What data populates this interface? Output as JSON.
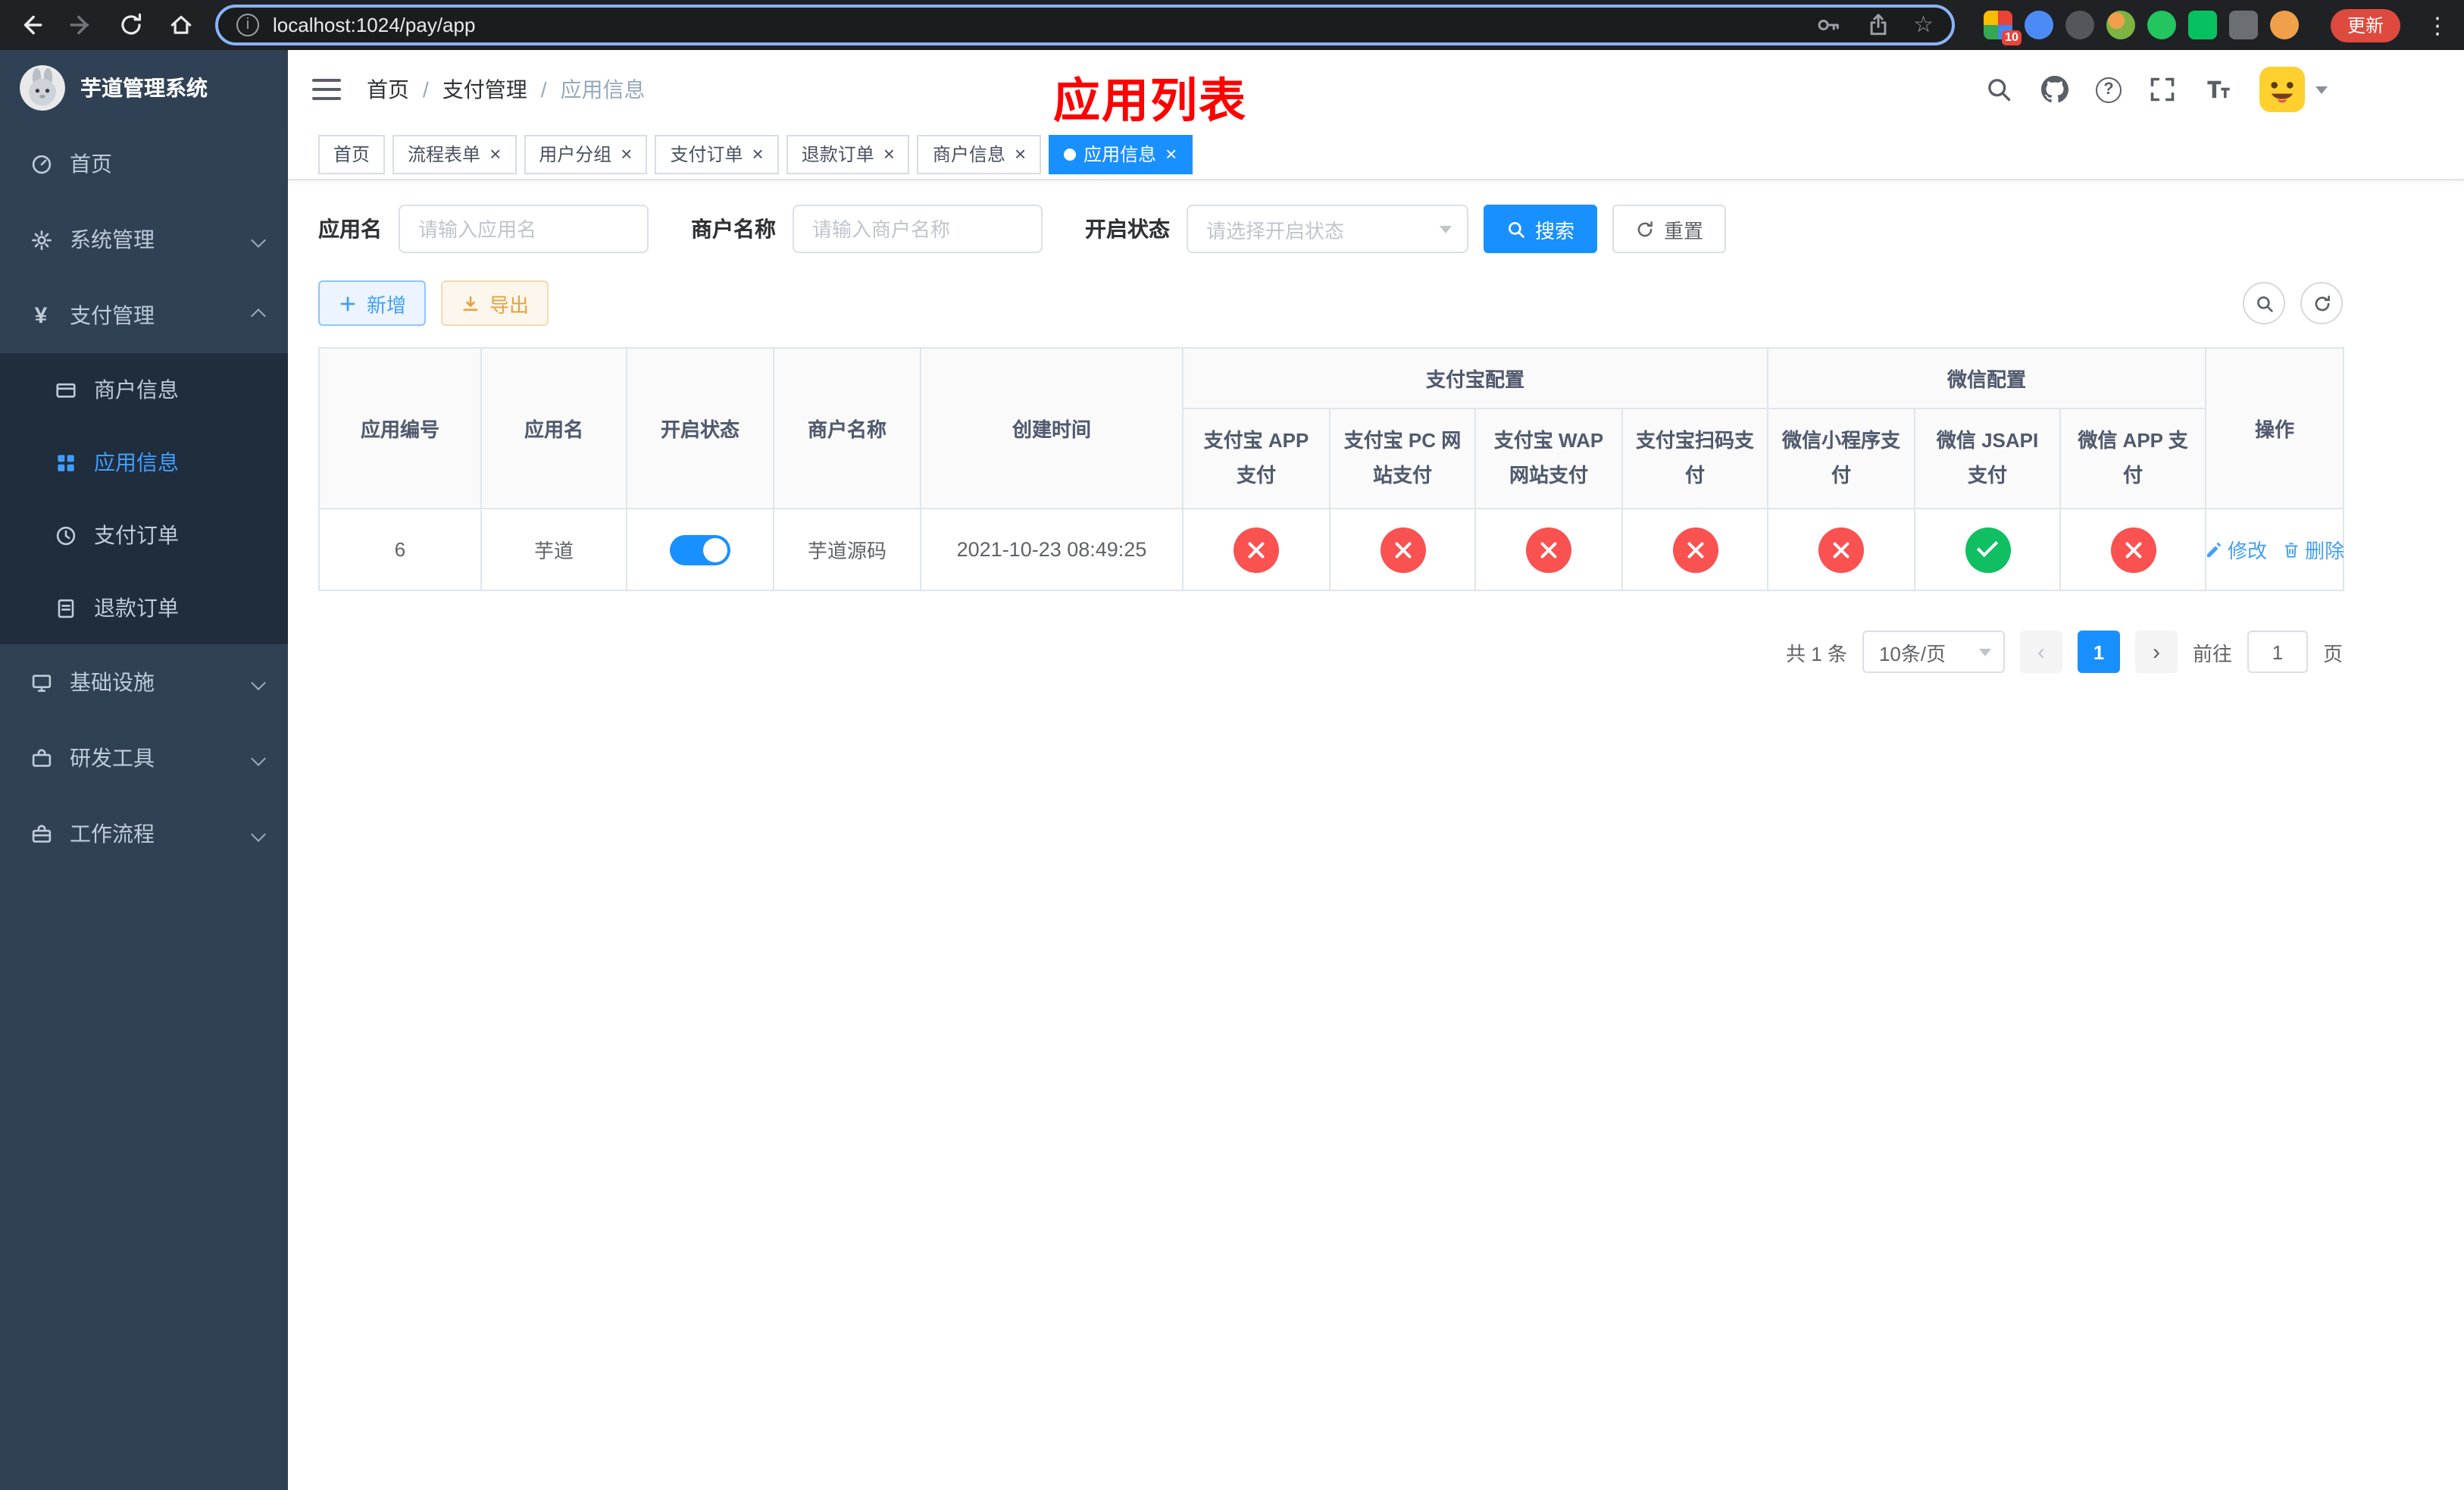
{
  "browser": {
    "url": "localhost:1024/pay/app",
    "update_label": "更新",
    "extension_badge": "10"
  },
  "icons": {
    "close": "×",
    "prev": "‹",
    "next": "›",
    "kebab": "⋮",
    "star": "☆",
    "yen": "¥",
    "info": "i",
    "help": "?"
  },
  "sidebar": {
    "title": "芋道管理系统",
    "items": {
      "home": "首页",
      "system": "系统管理",
      "payment": "支付管理",
      "infrastructure": "基础设施",
      "devtools": "研发工具",
      "workflow": "工作流程"
    },
    "payment_children": [
      "商户信息",
      "应用信息",
      "支付订单",
      "退款订单"
    ]
  },
  "navbar": {
    "breadcrumb": [
      "首页",
      "支付管理",
      "应用信息"
    ],
    "separator": "/",
    "page_title": "应用列表"
  },
  "tabs": [
    {
      "label": "首页",
      "closable": false,
      "active": false
    },
    {
      "label": "流程表单",
      "closable": true,
      "active": false
    },
    {
      "label": "用户分组",
      "closable": true,
      "active": false
    },
    {
      "label": "支付订单",
      "closable": true,
      "active": false
    },
    {
      "label": "退款订单",
      "closable": true,
      "active": false
    },
    {
      "label": "商户信息",
      "closable": true,
      "active": false
    },
    {
      "label": "应用信息",
      "closable": true,
      "active": true
    }
  ],
  "filters": {
    "app_name_label": "应用名",
    "app_name_placeholder": "请输入应用名",
    "merchant_label": "商户名称",
    "merchant_placeholder": "请输入商户名称",
    "status_label": "开启状态",
    "status_placeholder": "请选择开启状态",
    "search_label": "搜索",
    "reset_label": "重置"
  },
  "toolbar": {
    "add_label": "新增",
    "export_label": "导出"
  },
  "table": {
    "columns": {
      "app_id": "应用编号",
      "app_name": "应用名",
      "status": "开启状态",
      "merchant": "商户名称",
      "created": "创建时间",
      "alipay_group": "支付宝配置",
      "alipay_app": "支付宝 APP 支付",
      "alipay_pc": "支付宝 PC 网站支付",
      "alipay_wap": "支付宝 WAP 网站支付",
      "alipay_qr": "支付宝扫码支付",
      "wechat_group": "微信配置",
      "wechat_lite": "微信小程序支付",
      "wechat_jsapi": "微信 JSAPI 支付",
      "wechat_app": "微信 APP 支付",
      "actions": "操作"
    },
    "rows": [
      {
        "app_id": "6",
        "app_name": "芋道",
        "enabled": true,
        "merchant": "芋道源码",
        "created": "2021-10-23 08:49:25",
        "alipay_app": false,
        "alipay_pc": false,
        "alipay_wap": false,
        "alipay_qr": false,
        "wechat_lite": false,
        "wechat_jsapi": true,
        "wechat_app": false,
        "edit_label": "修改",
        "delete_label": "删除"
      }
    ]
  },
  "pagination": {
    "total": "共 1 条",
    "page_size": "10条/页",
    "page": "1",
    "goto_label": "前往",
    "goto_value": "1",
    "unit_label": "页"
  },
  "colors": {
    "primary": "#1890ff",
    "link": "#409eff",
    "status_closed": "#fa5151",
    "status_open": "#0fbf61",
    "page_title_red": "#ff0000",
    "sidebar_bg": "#304156",
    "sidebar_submenu_bg": "#1f2d3d",
    "tab_active": "#1890ff"
  }
}
